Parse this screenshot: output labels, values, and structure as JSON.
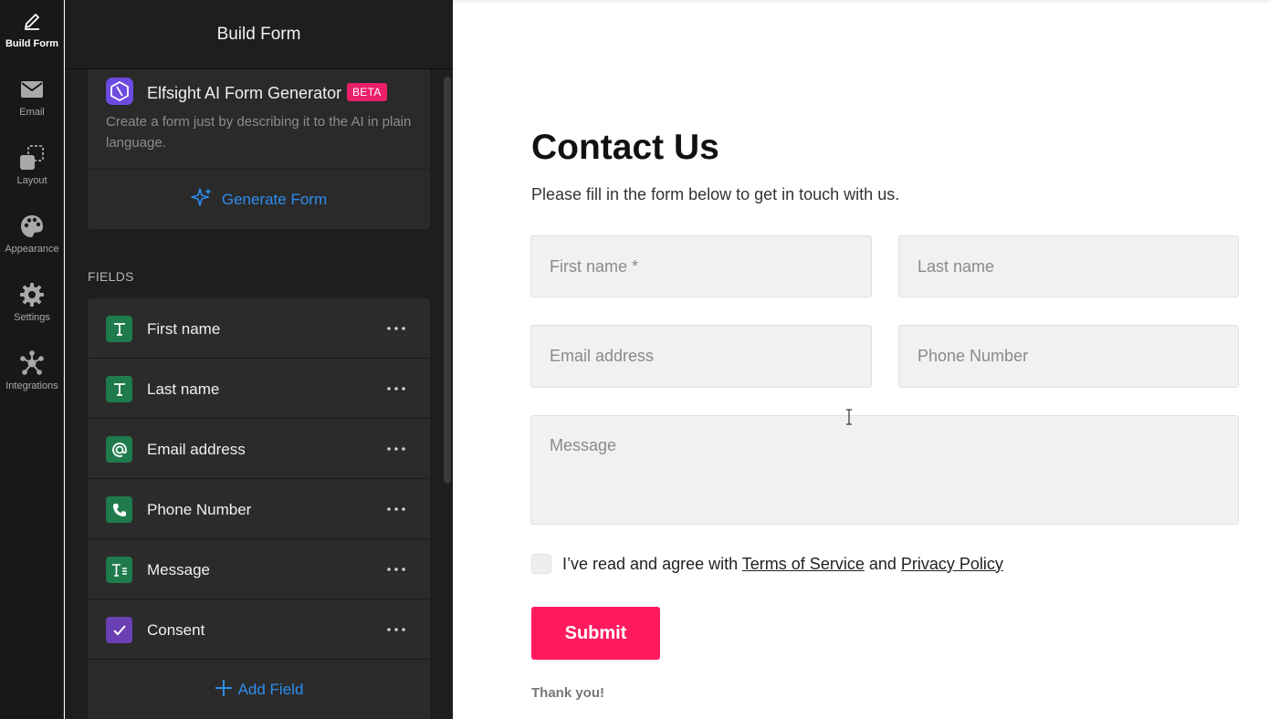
{
  "rail": {
    "items": [
      {
        "label": "Build Form",
        "icon": "pencil-icon",
        "active": true
      },
      {
        "label": "Email",
        "icon": "envelope-icon"
      },
      {
        "label": "Layout",
        "icon": "layout-icon"
      },
      {
        "label": "Appearance",
        "icon": "palette-icon"
      },
      {
        "label": "Settings",
        "icon": "gear-icon"
      },
      {
        "label": "Integrations",
        "icon": "integrations-icon"
      }
    ]
  },
  "panel": {
    "title": "Build Form",
    "ai": {
      "title": "Elfsight AI Form Generator",
      "badge": "BETA",
      "description": "Create a form just by describing it to the AI in plain language.",
      "button": "Generate Form"
    },
    "fields_label": "FIELDS",
    "fields": [
      {
        "name": "First name",
        "icon": "text-field-icon"
      },
      {
        "name": "Last name",
        "icon": "text-field-icon"
      },
      {
        "name": "Email address",
        "icon": "at-sign-icon"
      },
      {
        "name": "Phone Number",
        "icon": "phone-icon"
      },
      {
        "name": "Message",
        "icon": "textarea-icon"
      },
      {
        "name": "Consent",
        "icon": "checkbox-icon"
      }
    ],
    "add_field": "Add Field"
  },
  "preview": {
    "title": "Contact Us",
    "subtitle": "Please fill in the form below to get in touch with us.",
    "placeholders": {
      "first_name": "First name *",
      "last_name": "Last name",
      "email": "Email address",
      "phone": "Phone Number",
      "message": "Message"
    },
    "consent": {
      "prefix": "I’ve read and agree with ",
      "terms": "Terms of Service",
      "middle": " and ",
      "privacy": "Privacy Policy"
    },
    "submit": "Submit",
    "thanks": "Thank you!"
  },
  "colors": {
    "accent_blue": "#2e8df0",
    "submit_pink": "#ff1a5e",
    "beta_pink": "#ec1f6a",
    "field_icon_green": "#1f7a4c",
    "field_icon_purple": "#6a3fb3"
  }
}
